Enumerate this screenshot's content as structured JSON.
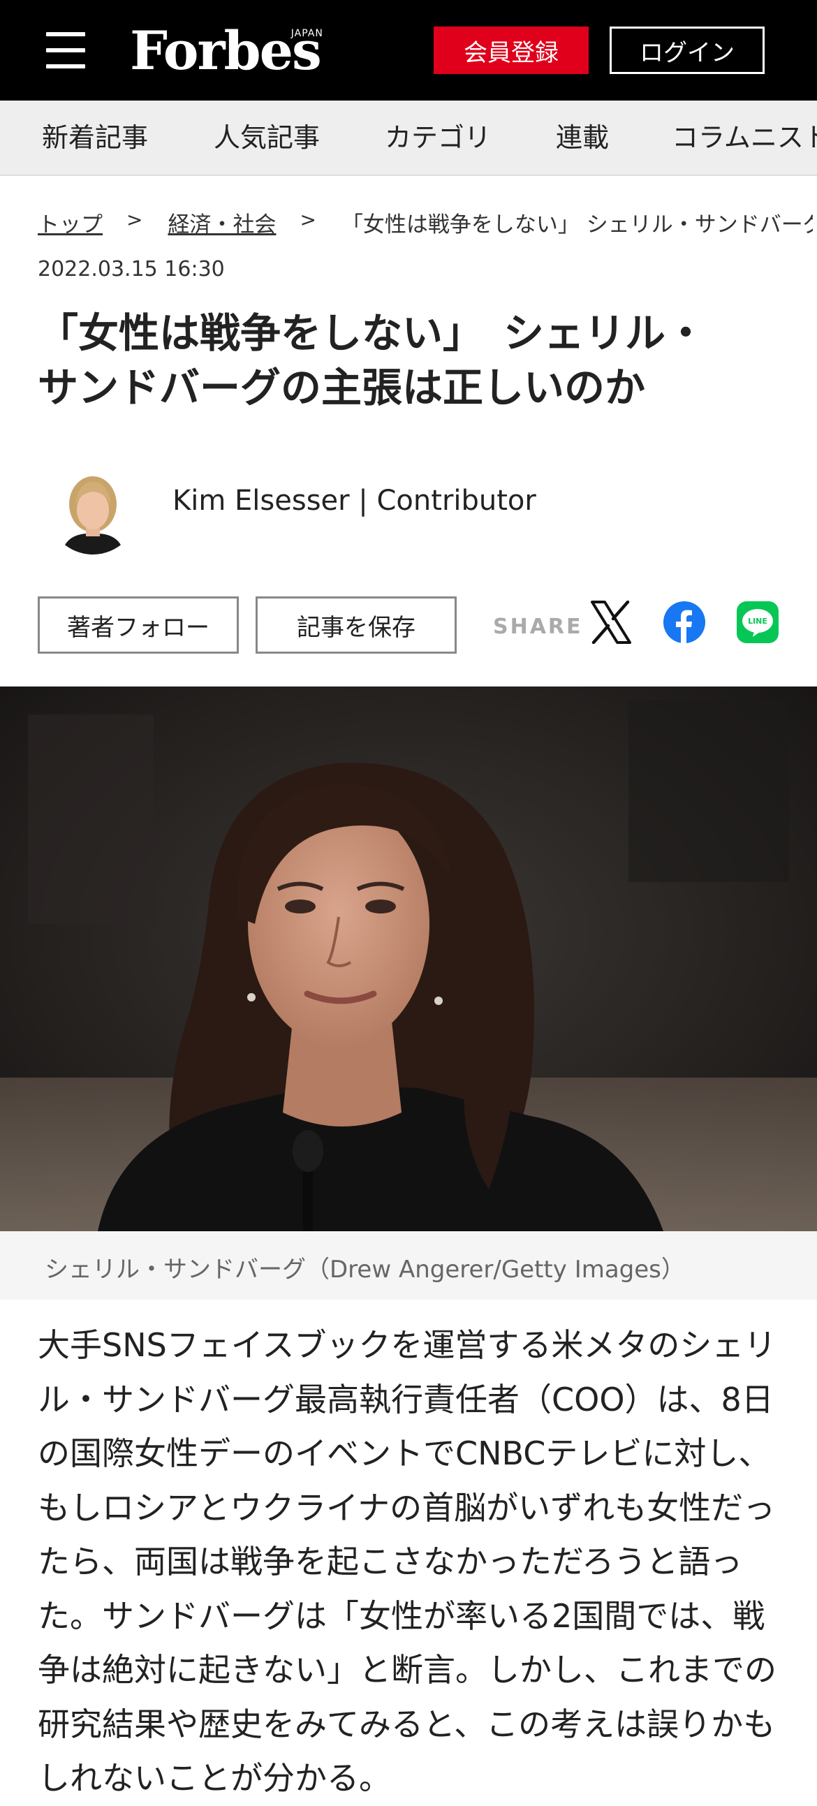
{
  "header": {
    "logo": "Forbes",
    "logo_sub": "JAPAN",
    "register_label": "会員登録",
    "login_label": "ログイン"
  },
  "nav": {
    "items": [
      "新着記事",
      "人気記事",
      "カテゴリ",
      "連載",
      "コラムニスト"
    ]
  },
  "breadcrumb": {
    "items": [
      "トップ",
      "経済・社会",
      "「女性は戦争をしない」 シェリル・サンドバーグの主張は正しいのか"
    ]
  },
  "article": {
    "datetime": "2022.03.15 16:30",
    "title_line1": "「女性は戦争をしない」　シェリル・",
    "title_line2": "サンドバーグの主張は正しいのか",
    "author": "Kim Elsesser | Contributor",
    "follow_label": "著者フォロー",
    "save_label": "記事を保存",
    "share_label": "SHARE",
    "image_caption": "シェリル・サンドバーグ（Drew Angerer/Getty Images）",
    "body": "大手SNSフェイスブックを運営する米メタのシェリル・サンドバーグ最高執行責任者（COO）は、8日の国際女性デーのイベントでCNBCテレビに対し、もしロシアとウクライナの首脳がいずれも女性だったら、両国は戦争を起こさなかっただろうと語った。サンドバーグは「女性が率いる2国間では、戦争は絶対に起きない」と断言。しかし、これまでの研究結果や歴史をみてみると、この考えは誤りかもしれないことが分かる。"
  },
  "colors": {
    "header_bg": "#000000",
    "register_bg": "#e0001b",
    "facebook": "#1877f2",
    "line": "#06c755"
  }
}
